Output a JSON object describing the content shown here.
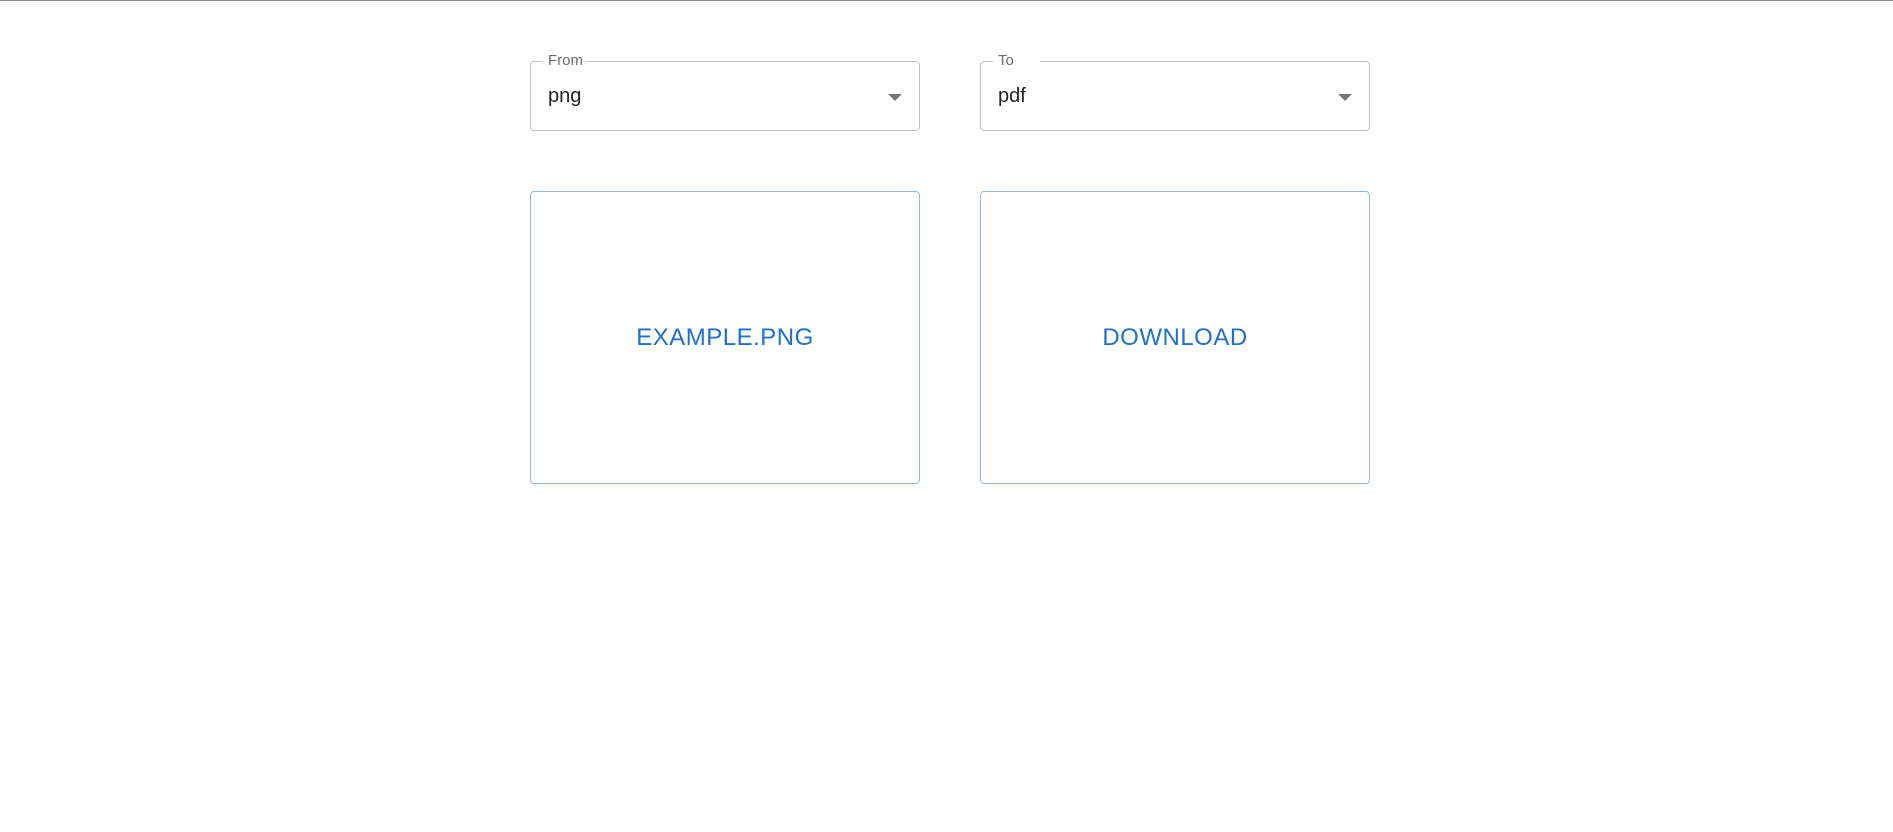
{
  "from_select": {
    "label": "From",
    "value": "png"
  },
  "to_select": {
    "label": "To",
    "value": "pdf"
  },
  "upload_button": {
    "label": "EXAMPLE.PNG"
  },
  "download_button": {
    "label": "DOWNLOAD"
  },
  "colors": {
    "accent": "#1e6fce",
    "button_border": "#90b8ea",
    "field_border": "#c4c4c4"
  }
}
